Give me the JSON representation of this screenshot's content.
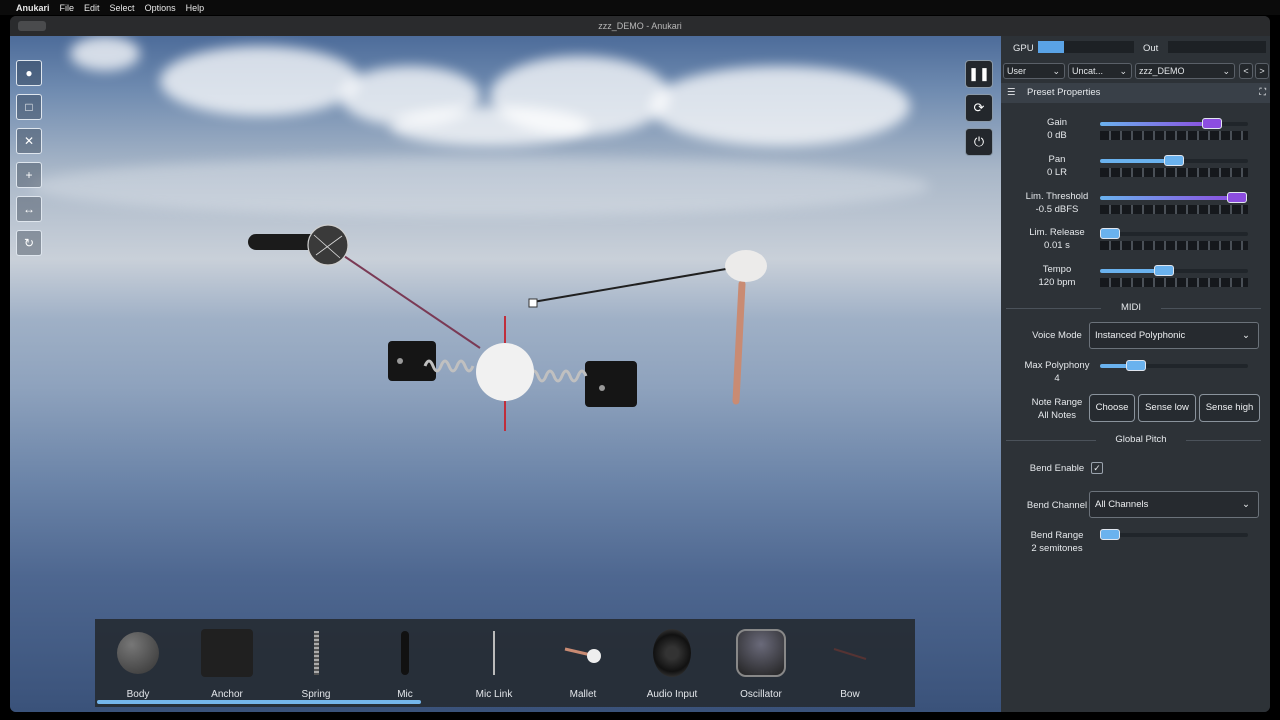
{
  "menubar": {
    "app": "Anukari",
    "items": [
      "File",
      "Edit",
      "Select",
      "Options",
      "Help"
    ]
  },
  "window": {
    "title": "zzz_DEMO - Anukari"
  },
  "meters": {
    "gpu_label": "GPU",
    "out_label": "Out"
  },
  "selectors": {
    "user": "User",
    "category": "Uncat...",
    "preset": "zzz_DEMO",
    "prev": "<",
    "next": ">"
  },
  "panel": {
    "section_title": "Preset Properties",
    "params": [
      {
        "name": "Gain",
        "value": "0 dB",
        "level": 0.8
      },
      {
        "name": "Pan",
        "value": "0 LR",
        "level": 0.5
      },
      {
        "name": "Lim. Threshold",
        "value": "-0.5 dBFS",
        "level": 0.99
      },
      {
        "name": "Lim. Release",
        "value": "0.01 s",
        "level": 0.0
      },
      {
        "name": "Tempo",
        "value": "120 bpm",
        "level": 0.42
      }
    ],
    "midi_heading": "MIDI",
    "voice_mode_label": "Voice Mode",
    "voice_mode_value": "Instanced Polyphonic",
    "max_polyphony_label": "Max Polyphony",
    "max_polyphony_value": "4",
    "max_polyphony_level": 0.2,
    "note_range_label": "Note Range",
    "note_range_value": "All Notes",
    "choose_btn": "Choose",
    "sense_low_btn": "Sense low",
    "sense_high_btn": "Sense high",
    "global_pitch_heading": "Global Pitch",
    "bend_enable_label": "Bend Enable",
    "bend_enable_check": "✓",
    "bend_channel_label": "Bend Channel",
    "bend_channel_value": "All Channels",
    "bend_range_label": "Bend Range",
    "bend_range_value": "2 semitones",
    "bend_range_level": 0.0
  },
  "palette": {
    "items": [
      {
        "label": "Body",
        "icon": "sphere-icon"
      },
      {
        "label": "Anchor",
        "icon": "anchor-icon"
      },
      {
        "label": "Spring",
        "icon": "spring-icon"
      },
      {
        "label": "Mic",
        "icon": "mic-icon"
      },
      {
        "label": "Mic Link",
        "icon": "mic-link-icon"
      },
      {
        "label": "Mallet",
        "icon": "mallet-icon"
      },
      {
        "label": "Audio Input",
        "icon": "speaker-icon"
      },
      {
        "label": "Oscillator",
        "icon": "oscillator-icon"
      },
      {
        "label": "Bow",
        "icon": "bow-icon"
      }
    ]
  },
  "colors": {
    "accent": "#74b6ec",
    "accent_purple": "#8c4de0",
    "panel_bg": "#2d3237"
  }
}
